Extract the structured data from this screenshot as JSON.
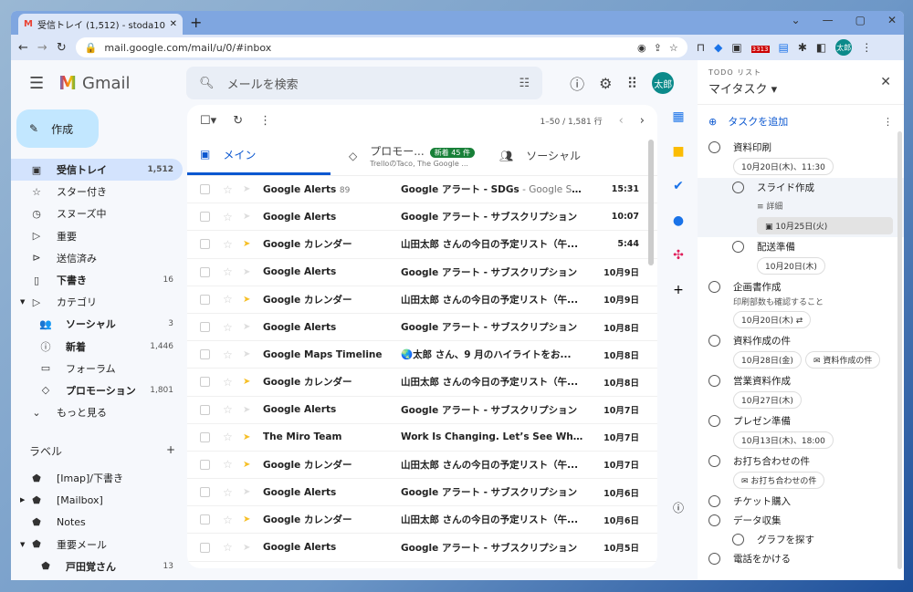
{
  "browser": {
    "tab_title": "受信トレイ (1,512) - stoda1000@g",
    "url": "mail.google.com/mail/u/0/#inbox",
    "ext_badge": "3313",
    "profile": "太郎"
  },
  "header": {
    "app": "Gmail",
    "search_placeholder": "メールを検索",
    "avatar": "太郎"
  },
  "compose": "作成",
  "nav": [
    {
      "icon": "inbox-icon",
      "g": "▣",
      "label": "受信トレイ",
      "count": "1,512",
      "active": true
    },
    {
      "icon": "star-icon",
      "g": "☆",
      "label": "スター付き"
    },
    {
      "icon": "clock-icon",
      "g": "◷",
      "label": "スヌーズ中"
    },
    {
      "icon": "important-icon",
      "g": "▷",
      "label": "重要"
    },
    {
      "icon": "send-icon",
      "g": "⊳",
      "label": "送信済み"
    },
    {
      "icon": "draft-icon",
      "g": "▯",
      "label": "下書き",
      "count": "16",
      "bold": true
    },
    {
      "icon": "label-icon",
      "g": "▷",
      "label": "カテゴリ",
      "caret": "▼"
    },
    {
      "icon": "people-icon",
      "g": "👥",
      "label": "ソーシャル",
      "count": "3",
      "bold": true,
      "sub": true
    },
    {
      "icon": "info-icon",
      "g": "ⓘ",
      "label": "新着",
      "count": "1,446",
      "bold": true,
      "sub": true
    },
    {
      "icon": "forum-icon",
      "g": "▭",
      "label": "フォーラム",
      "sub": true
    },
    {
      "icon": "tag-icon",
      "g": "◇",
      "label": "プロモーション",
      "count": "1,801",
      "bold": true,
      "sub": true
    },
    {
      "icon": "chevron-down-icon",
      "g": "⌄",
      "label": "もっと見る"
    }
  ],
  "labels_title": "ラベル",
  "labels": [
    {
      "label": "[Imap]/下書き"
    },
    {
      "label": "[Mailbox]",
      "caret": "▶"
    },
    {
      "label": "Notes"
    },
    {
      "label": "重要メール",
      "caret": "▼"
    },
    {
      "label": "戸田覚さん",
      "count": "13",
      "bold": true,
      "sub": true
    }
  ],
  "list": {
    "pagination": "1–50 / 1,581 行",
    "tabs": [
      {
        "label": "メイン"
      },
      {
        "label": "プロモー...",
        "badge": "新着 45 件",
        "sub": "TrelloのTaco, The Google ..."
      },
      {
        "label": "ソーシャル"
      }
    ],
    "rows": [
      {
        "sender": "Google Alerts",
        "cnt": "89",
        "subject": "Google アラート - SDGs",
        "snippet": " - Google SD...",
        "date": "15:31",
        "imp": false
      },
      {
        "sender": "Google Alerts",
        "subject": "Google アラート - サブスクリプション",
        "date": "10:07",
        "imp": false
      },
      {
        "sender": "Google カレンダー",
        "subject": "山田太郎 さんの今日の予定リスト（午...",
        "date": "5:44",
        "imp": true
      },
      {
        "sender": "Google Alerts",
        "subject": "Google アラート - サブスクリプション",
        "date": "10月9日",
        "imp": false
      },
      {
        "sender": "Google カレンダー",
        "subject": "山田太郎 さんの今日の予定リスト（午...",
        "date": "10月9日",
        "imp": true
      },
      {
        "sender": "Google Alerts",
        "subject": "Google アラート - サブスクリプション",
        "date": "10月8日",
        "imp": false
      },
      {
        "sender": "Google Maps Timeline",
        "subject": "🌏太郎 さん、9 月のハイライトをお...",
        "date": "10月8日",
        "imp": false
      },
      {
        "sender": "Google カレンダー",
        "subject": "山田太郎 さんの今日の予定リスト（午...",
        "date": "10月8日",
        "imp": true
      },
      {
        "sender": "Google Alerts",
        "subject": "Google アラート - サブスクリプション",
        "date": "10月7日",
        "imp": false
      },
      {
        "sender": "The Miro Team",
        "subject": "Work Is Changing. Let’s See What’s...",
        "date": "10月7日",
        "imp": true
      },
      {
        "sender": "Google カレンダー",
        "subject": "山田太郎 さんの今日の予定リスト（午...",
        "date": "10月7日",
        "imp": true
      },
      {
        "sender": "Google Alerts",
        "subject": "Google アラート - サブスクリプション",
        "date": "10月6日",
        "imp": false
      },
      {
        "sender": "Google カレンダー",
        "subject": "山田太郎 さんの今日の予定リスト（午...",
        "date": "10月6日",
        "imp": true
      },
      {
        "sender": "Google Alerts",
        "subject": "Google アラート - サブスクリプション",
        "date": "10月5日",
        "imp": false
      }
    ]
  },
  "tasks": {
    "subtitle": "TODO リスト",
    "title": "マイタスク",
    "add": "タスクを追加",
    "items": [
      {
        "title": "資料印刷",
        "chips": [
          "10月20日(木)、11:30"
        ]
      },
      {
        "title": "スライド作成",
        "child": true,
        "selected": true,
        "detail": "詳細",
        "date": "10月25日(火)"
      },
      {
        "title": "配送準備",
        "child": true,
        "chips": [
          "10月20日(木)"
        ]
      },
      {
        "title": "企画書作成",
        "note": "印刷部数も確認すること",
        "chips": [
          "10月20日(木) ⇄"
        ]
      },
      {
        "title": "資料作成の件",
        "chips": [
          "10月28日(金)",
          "✉ 資料作成の件"
        ]
      },
      {
        "title": "営業資料作成",
        "chips": [
          "10月27日(木)"
        ]
      },
      {
        "title": "プレゼン準備",
        "chips": [
          "10月13日(木)、18:00"
        ]
      },
      {
        "title": "お打ち合わせの件",
        "chips": [
          "✉ お打ち合わせの件"
        ]
      },
      {
        "title": "チケット購入"
      },
      {
        "title": "データ収集"
      },
      {
        "title": "グラフを探す",
        "child": true
      },
      {
        "title": "電話をかける"
      }
    ]
  }
}
